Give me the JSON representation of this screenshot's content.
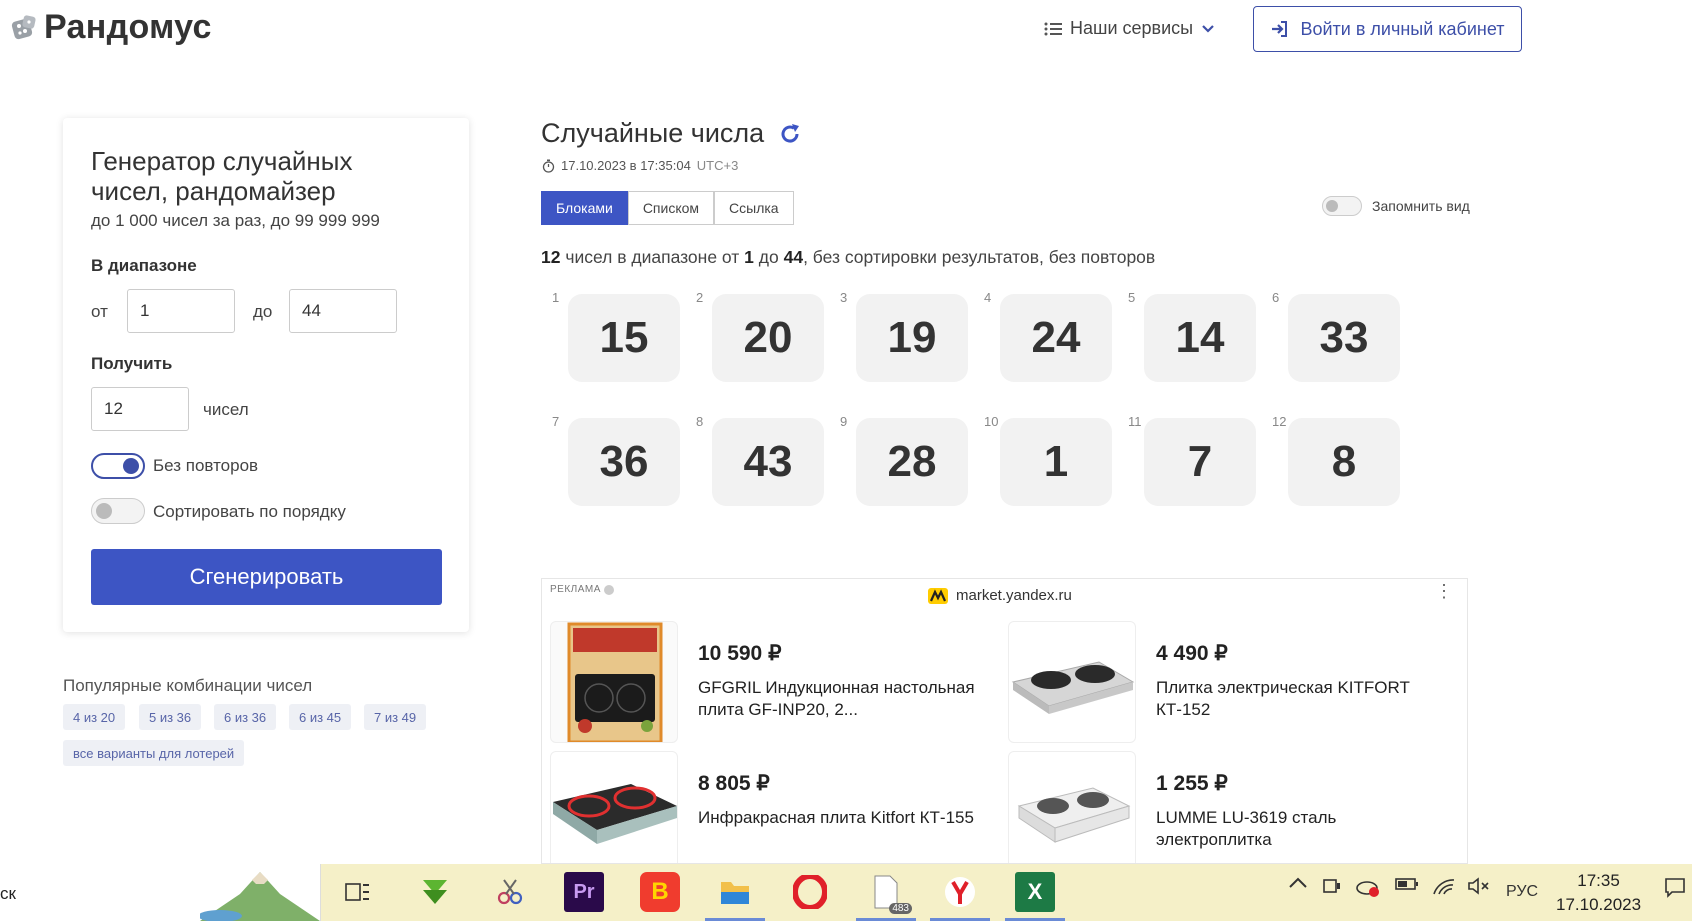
{
  "header": {
    "logo_text": "Рандомус",
    "services_label": "Наши сервисы",
    "login_label": "Войти в личный кабинет"
  },
  "form": {
    "title": "Генератор случайных чисел, рандомайзер",
    "subtitle": "до 1 000 чисел за раз, до 99 999 999",
    "range_label": "В диапазоне",
    "from_label": "от",
    "from_value": "1",
    "to_label": "до",
    "to_value": "44",
    "get_label": "Получить",
    "count_value": "12",
    "count_unit": "чисел",
    "no_repeat_label": "Без повторов",
    "no_repeat_on": true,
    "sort_label": "Сортировать по порядку",
    "sort_on": false,
    "generate_label": "Сгенерировать"
  },
  "popular": {
    "title": "Популярные комбинации чисел",
    "chips": [
      "4 из 20",
      "5 из 36",
      "6 из 36",
      "6 из 45",
      "7 из 49"
    ],
    "all_label": "все варианты для лотерей"
  },
  "result": {
    "title": "Случайные числа",
    "timestamp": "17.10.2023 в 17:35:04",
    "timezone": "UTC+3",
    "tabs": [
      "Блоками",
      "Списком",
      "Ссылка"
    ],
    "active_tab": "Блоками",
    "remember_label": "Запомнить вид",
    "summary_count": "12",
    "summary_part1": "чисел в диапазоне от",
    "summary_from": "1",
    "summary_part2": "до",
    "summary_to": "44",
    "summary_part3": ", без сортировки результатов, без повторов",
    "numbers": [
      15,
      20,
      19,
      24,
      14,
      33,
      36,
      43,
      28,
      1,
      7,
      8
    ]
  },
  "ad": {
    "label": "РЕКЛАМА",
    "source": "market.yandex.ru",
    "products": [
      {
        "price": "10 590 ₽",
        "name": "GFGRIL Индукционная настольная плита GF-INP20, 2..."
      },
      {
        "price": "4 490 ₽",
        "name": "Плитка электрическая KITFORT КТ-152"
      },
      {
        "price": "8 805 ₽",
        "name": "Инфракрасная плита Kitfort КТ-155"
      },
      {
        "price": "1 255 ₽",
        "name": "LUMME LU-3619 сталь электроплитка"
      }
    ]
  },
  "taskbar": {
    "search_text": "ск",
    "file_badge": "483",
    "lang": "РУС",
    "time": "17:35",
    "date": "17.10.2023"
  },
  "colors": {
    "accent": "#3d55c4",
    "taskbar_bg": "#f5f0c8"
  }
}
